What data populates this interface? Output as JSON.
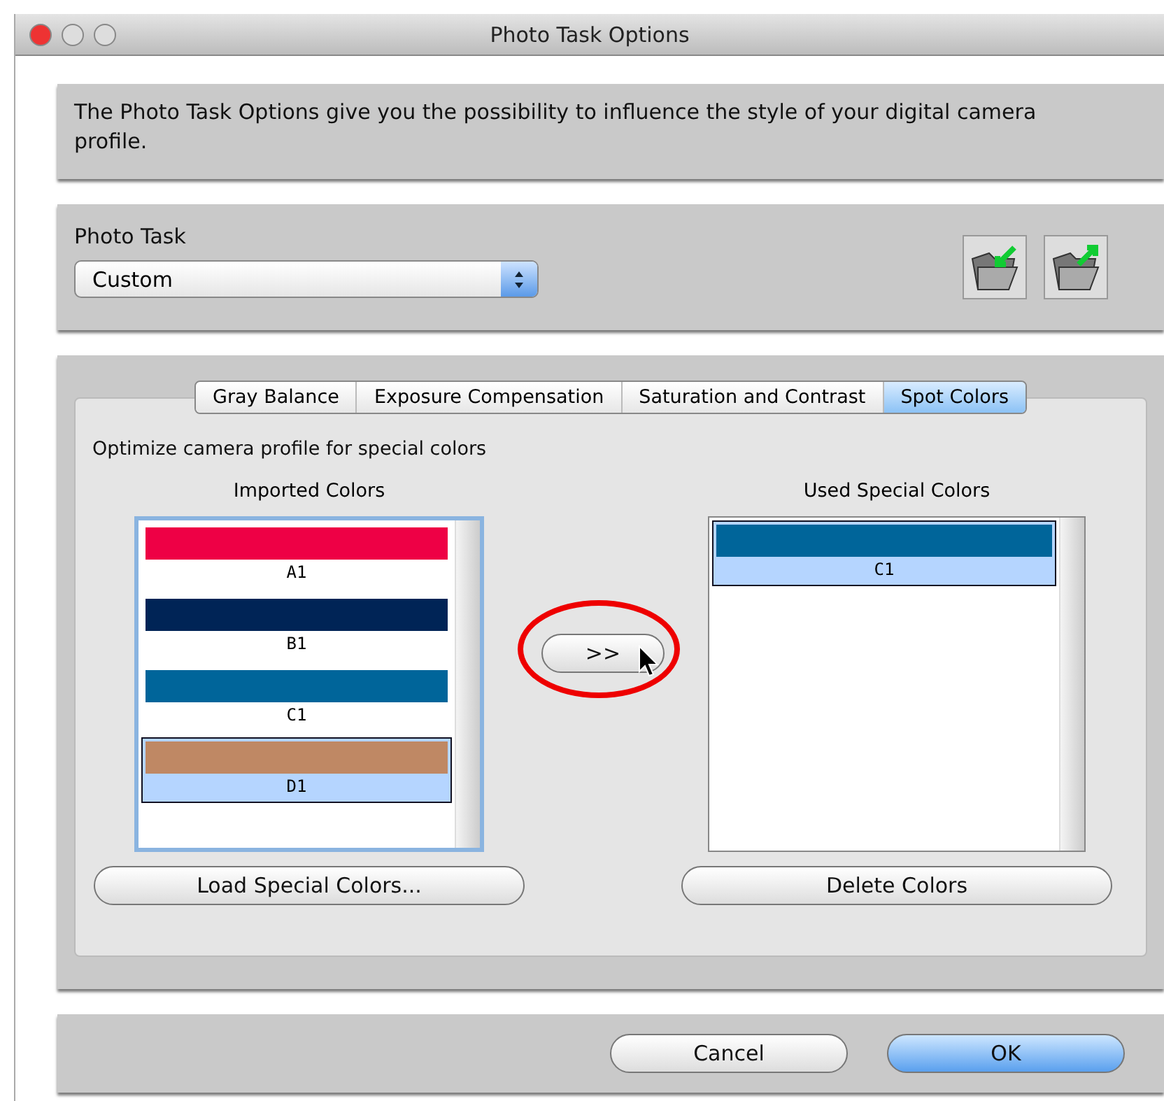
{
  "window": {
    "title": "Photo Task Options"
  },
  "intro": {
    "text": "The Photo Task Options give you the possibility to influence the style of your digital camera profile."
  },
  "photo_task": {
    "label": "Photo Task",
    "value": "Custom"
  },
  "tabs": [
    {
      "label": "Gray Balance",
      "selected": false
    },
    {
      "label": "Exposure Compensation",
      "selected": false
    },
    {
      "label": "Saturation and Contrast",
      "selected": false
    },
    {
      "label": "Spot Colors",
      "selected": true
    }
  ],
  "description": "Optimize camera profile for special colors",
  "imported": {
    "title": "Imported Colors",
    "items": [
      {
        "name": "A1",
        "color": "#ee0045",
        "selected": false
      },
      {
        "name": "B1",
        "color": "#002456",
        "selected": false
      },
      {
        "name": "C1",
        "color": "#00659a",
        "selected": false
      },
      {
        "name": "D1",
        "color": "#bf8864",
        "selected": true
      }
    ],
    "button": "Load Special Colors..."
  },
  "move_button": ">>",
  "used": {
    "title": "Used Special Colors",
    "items": [
      {
        "name": "C1",
        "color": "#00659a",
        "selected": true
      }
    ],
    "button": "Delete Colors"
  },
  "buttons": [
    {
      "label": "Cancel",
      "default": false
    },
    {
      "label": "OK",
      "default": true
    }
  ]
}
